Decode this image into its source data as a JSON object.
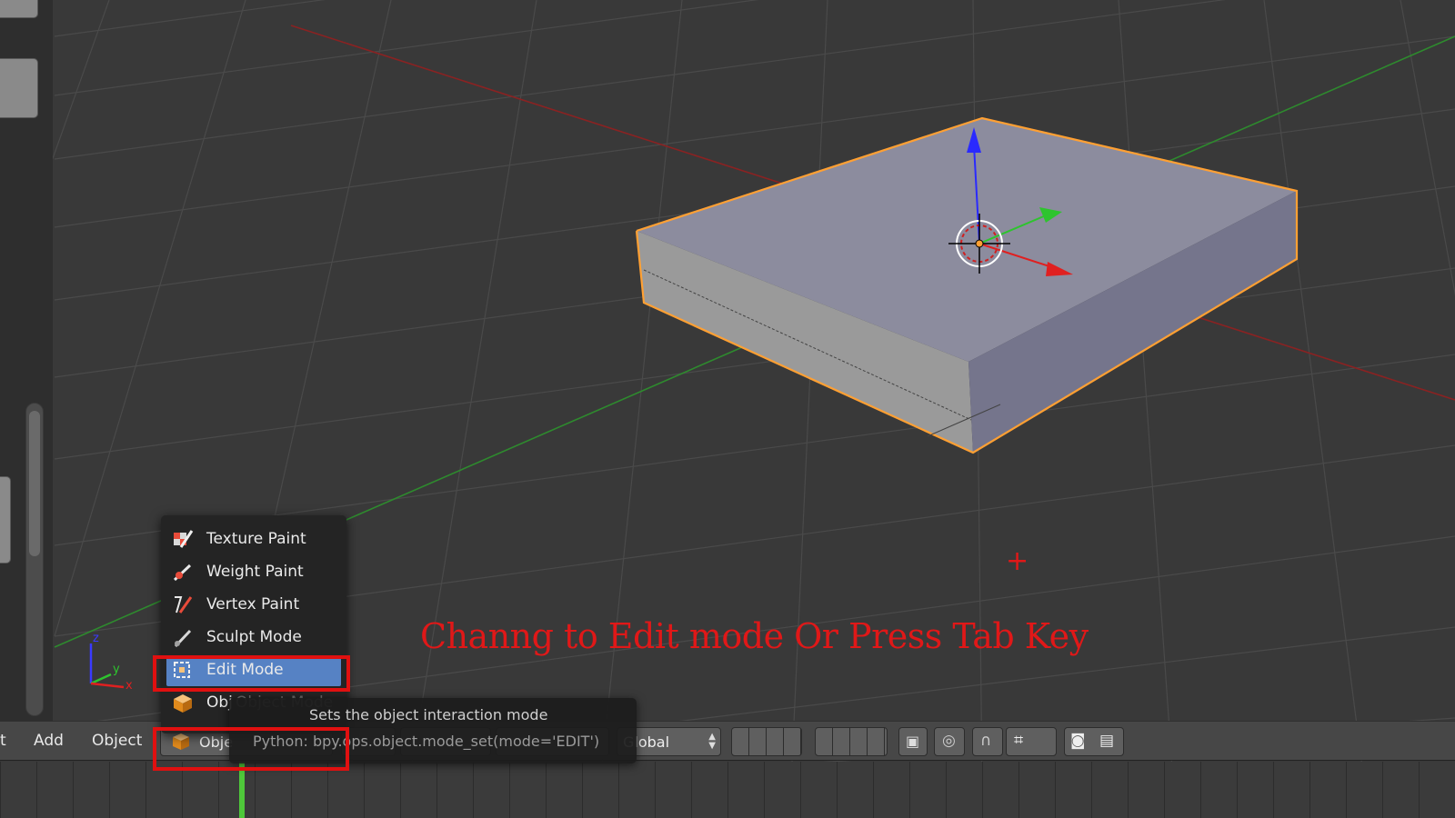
{
  "viewport": {
    "annotation_text": "Channg to Edit mode Or Press Tab Key",
    "cursor_mark": "+",
    "axis_gizmo": {
      "z": "z",
      "y": "y",
      "x": "x"
    }
  },
  "mode_menu": {
    "items": [
      {
        "label": "Texture Paint",
        "icon": "texture-paint-icon"
      },
      {
        "label": "Weight Paint",
        "icon": "weight-paint-icon"
      },
      {
        "label": "Vertex Paint",
        "icon": "vertex-paint-icon"
      },
      {
        "label": "Sculpt Mode",
        "icon": "sculpt-icon"
      },
      {
        "label": "Edit Mode",
        "icon": "edit-mode-icon",
        "active": true
      },
      {
        "label": "Obj",
        "icon": "object-cube-icon"
      }
    ],
    "hidden_label": "Object Mode",
    "highlight_color": "#e01010",
    "active_color": "#5682c4"
  },
  "tooltip": {
    "description": "Sets the object interaction mode",
    "python": "Python: bpy.ops.object.mode_set(mode='EDIT')"
  },
  "header": {
    "menu_cut": "t",
    "add_label": "Add",
    "object_label": "Object",
    "mode_select_label": "Obje",
    "orientation_label": "Global"
  },
  "colors": {
    "annotation": "#e01818",
    "selection_outline": "#ffa033",
    "timeline_frame": "#4fc83a"
  }
}
